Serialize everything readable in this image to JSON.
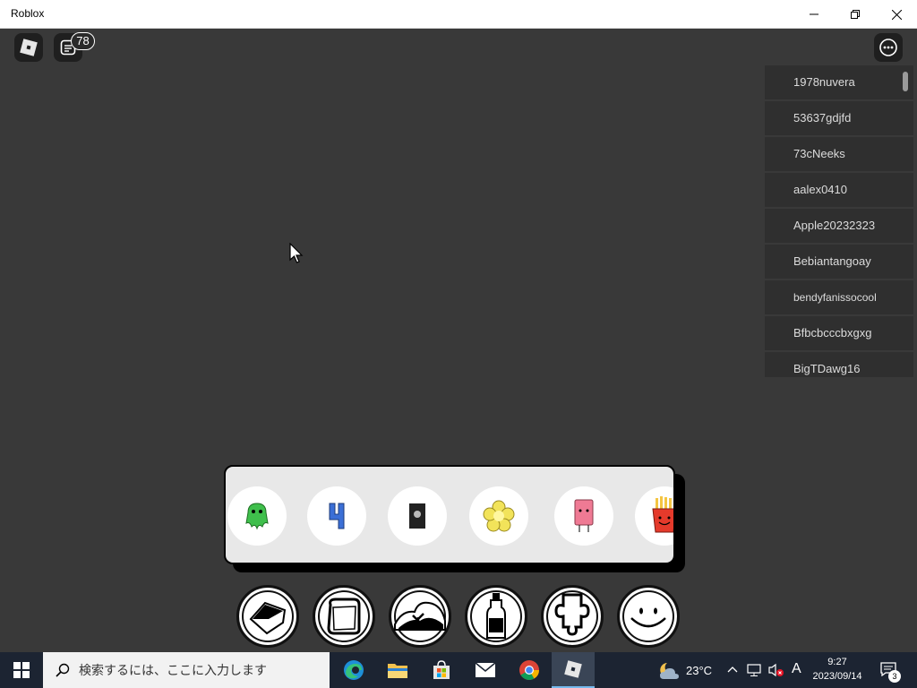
{
  "window": {
    "title": "Roblox"
  },
  "top_bar": {
    "chat_badge": "78"
  },
  "players": [
    "1978nuvera",
    "53637gdjfd",
    "73cNeeks",
    "aalex0410",
    "Apple20232323",
    "Bebiantangoay",
    "bendyfanissocool",
    "Bfbcbcccbxgxg",
    "BigTDawg16"
  ],
  "items": [
    {
      "icon": "green-character-icon",
      "color": "#3fbf4c"
    },
    {
      "icon": "blue-four-character-icon",
      "color": "#3b6fd6"
    },
    {
      "icon": "black-card-icon",
      "color": "#222222"
    },
    {
      "icon": "yellow-flower-character-icon",
      "color": "#f2e35a"
    },
    {
      "icon": "pink-eraser-character-icon",
      "color": "#ef7a94"
    },
    {
      "icon": "fries-character-icon",
      "color": "#e53a2b"
    }
  ],
  "categories": [
    {
      "icon": "shape-icon"
    },
    {
      "icon": "bread-icon"
    },
    {
      "icon": "landscape-icon"
    },
    {
      "icon": "bottle-icon"
    },
    {
      "icon": "puzzle-icon"
    },
    {
      "icon": "face-icon"
    }
  ],
  "taskbar": {
    "search_placeholder": "検索するには、ここに入力します",
    "weather_temp": "23°C",
    "ime_indicator": "A",
    "time": "9:27",
    "date": "2023/09/14",
    "notification_count": "3"
  }
}
